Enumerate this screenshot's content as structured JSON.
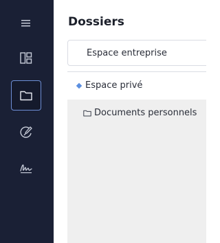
{
  "sidebar": {
    "items": [
      {
        "name": "menu",
        "icon": "hamburger-menu-icon"
      },
      {
        "name": "dashboard",
        "icon": "dashboard-layout-icon"
      },
      {
        "name": "folders",
        "icon": "folder-icon",
        "active": true
      },
      {
        "name": "sign",
        "icon": "sign-pen-icon"
      },
      {
        "name": "signature",
        "icon": "signature-icon"
      }
    ],
    "background": "#1a2035",
    "active_border": "#6e8fd6"
  },
  "main": {
    "title": "Dossiers",
    "space_selector": {
      "label": "Espace entreprise"
    },
    "tree": {
      "root_label": "Espace privé",
      "root_marker_color": "#5b8fe0",
      "children": [
        {
          "label": "Documents personnels",
          "icon": "folder-outline-icon"
        }
      ]
    }
  }
}
